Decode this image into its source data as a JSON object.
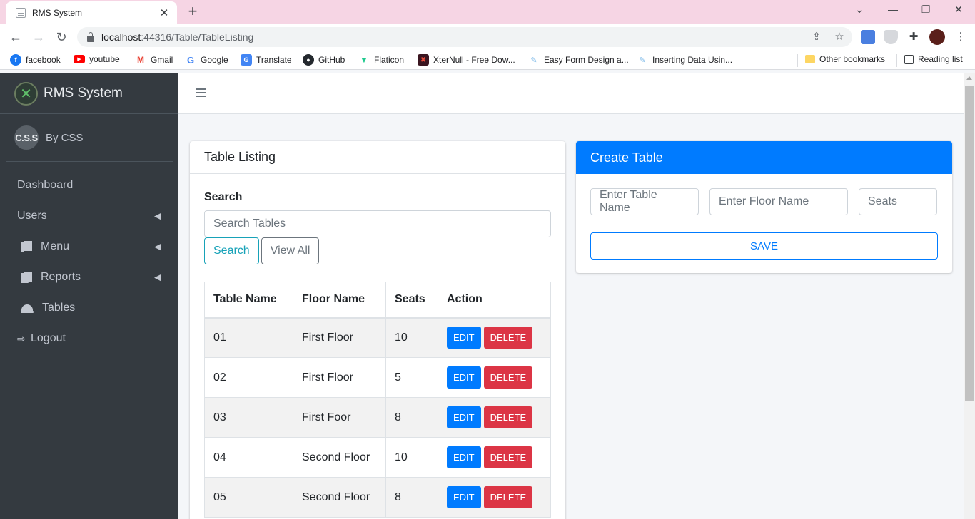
{
  "browser": {
    "tab_title": "RMS System",
    "tab_close": "✕",
    "new_tab": "+",
    "url_host": "localhost",
    "url_path": ":44316/Table/TableListing",
    "bookmarks": [
      {
        "label": "facebook",
        "icon": "facebook-icon",
        "color": "#1877f2",
        "glyph": "f"
      },
      {
        "label": "youtube",
        "icon": "youtube-icon",
        "color": "#ff0000",
        "glyph": "▶"
      },
      {
        "label": "Gmail",
        "icon": "gmail-icon",
        "color": "#ea4335",
        "glyph": "M"
      },
      {
        "label": "Google",
        "icon": "google-icon",
        "color": "#4285f4",
        "glyph": "G"
      },
      {
        "label": "Translate",
        "icon": "translate-icon",
        "color": "#4285f4",
        "glyph": "G"
      },
      {
        "label": "GitHub",
        "icon": "github-icon",
        "color": "#24292e",
        "glyph": "●"
      },
      {
        "label": "Flaticon",
        "icon": "flaticon-icon",
        "color": "#1fc98e",
        "glyph": "▼"
      },
      {
        "label": "XterNull - Free Dow...",
        "icon": "xternull-icon",
        "color": "#c0392b",
        "glyph": "✖"
      },
      {
        "label": "Easy Form Design a...",
        "icon": "page-icon",
        "color": "#7ab8e8",
        "glyph": "✎"
      },
      {
        "label": "Inserting Data Usin...",
        "icon": "page-icon",
        "color": "#7ab8e8",
        "glyph": "✎"
      }
    ],
    "other_bookmarks": "Other bookmarks",
    "reading_list": "Reading list"
  },
  "app": {
    "brand": "RMS System",
    "brand_glyph": "✕",
    "user_avatar_text": "C.S.S",
    "user_name": "By CSS",
    "nav": {
      "dashboard": "Dashboard",
      "users": "Users",
      "menu": "Menu",
      "reports": "Reports",
      "tables": "Tables",
      "logout": "Logout"
    },
    "colors": {
      "sidebar": "#343a40",
      "primary": "#007bff",
      "danger": "#dc3545",
      "info": "#17a2b8"
    }
  },
  "listing": {
    "header": "Table Listing",
    "search_label": "Search",
    "search_placeholder": "Search Tables",
    "search_button": "Search",
    "view_all_button": "View All",
    "columns": [
      "Table Name",
      "Floor Name",
      "Seats",
      "Action"
    ],
    "rows": [
      {
        "name": "01",
        "floor": "First Floor",
        "seats": "10"
      },
      {
        "name": "02",
        "floor": "First Floor",
        "seats": "5"
      },
      {
        "name": "03",
        "floor": "First Foor",
        "seats": "8"
      },
      {
        "name": "04",
        "floor": "Second Floor",
        "seats": "10"
      },
      {
        "name": "05",
        "floor": "Second Floor",
        "seats": "8"
      }
    ],
    "edit_label": "EDIT",
    "delete_label": "DELETE"
  },
  "create": {
    "header": "Create Table",
    "table_name_placeholder": "Enter Table Name",
    "floor_name_placeholder": "Enter Floor Name",
    "seats_placeholder": "Seats",
    "save_label": "SAVE"
  }
}
